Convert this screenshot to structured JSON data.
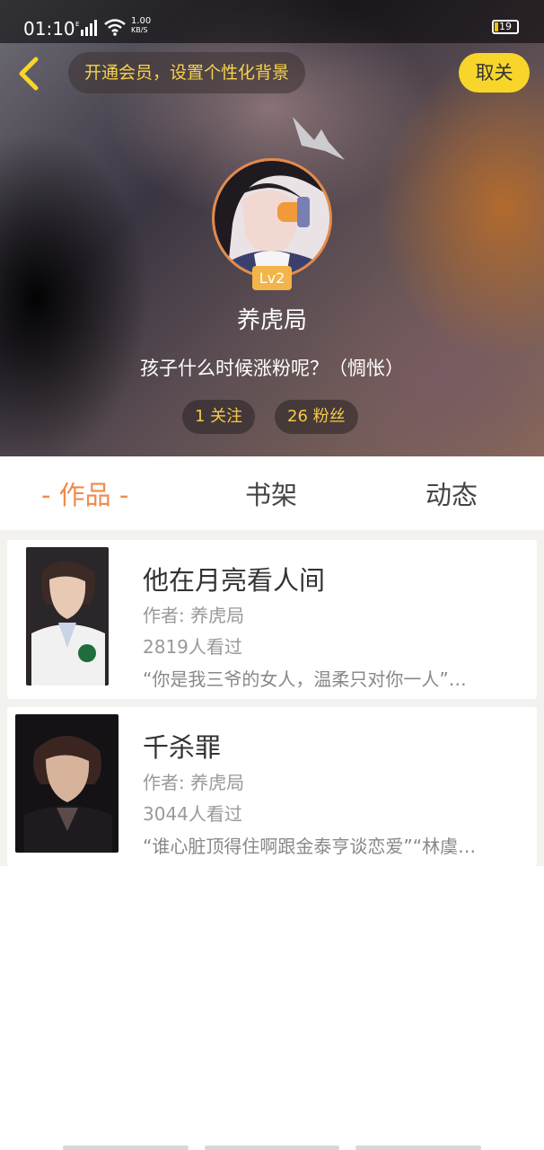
{
  "status_bar": {
    "time": "01:10",
    "speed_value": "1.00",
    "speed_unit": "KB/S",
    "battery": "19"
  },
  "header": {
    "vip_banner": "开通会员，设置个性化背景",
    "follow_button": "取关",
    "level": "Lv2",
    "username": "养虎局",
    "bio": "孩子什么时候涨粉呢？（惆怅）",
    "following": "1 关注",
    "followers": "26 粉丝"
  },
  "tabs": [
    {
      "label": "- 作品 -",
      "active": true
    },
    {
      "label": "书架",
      "active": false
    },
    {
      "label": "动态",
      "active": false
    }
  ],
  "works": [
    {
      "title": "他在月亮看人间",
      "author": "作者: 养虎局",
      "views": "2819人看过",
      "excerpt": "“你是我三爷的女人，温柔只对你一人”…"
    },
    {
      "title": "千杀罪",
      "author": "作者: 养虎局",
      "views": "3044人看过",
      "excerpt": "“谁心脏顶得住啊跟金泰亨谈恋爱”“林虞…"
    }
  ],
  "colors": {
    "accent_orange": "#ef8a4d",
    "vip_yellow": "#f6d34a",
    "button_yellow": "#f7d52a"
  }
}
